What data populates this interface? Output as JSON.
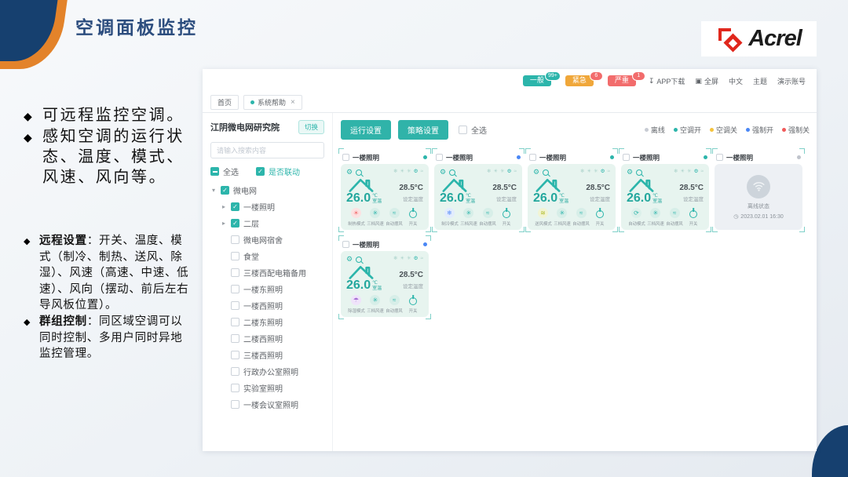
{
  "slide": {
    "title": "空调面板监控",
    "logo_text": "Acrel",
    "notes_top": [
      "可远程监控空调。",
      "感知空调的运行状态、温度、模式、风速、风向等。"
    ],
    "notes_bottom": [
      {
        "label": "远程设置",
        "text": "：开关、温度、模式（制冷、制热、送风、除湿）、风速（高速、中速、低速）、风向（摆动、前后左右导风板位置）。"
      },
      {
        "label": "群组控制",
        "text": "：同区域空调可以同时控制、多用户同时异地监控管理。"
      }
    ]
  },
  "app": {
    "header": {
      "pills": [
        {
          "label": "一般",
          "count": "99+",
          "color": "#2cb5ab",
          "badge_color": "#2cb5ab"
        },
        {
          "label": "紧急",
          "count": "6",
          "color": "#f0a73a",
          "badge_color": "#f26c6c"
        },
        {
          "label": "严重",
          "count": "1",
          "color": "#f26c6c",
          "badge_color": "#f26c6c"
        }
      ],
      "links": [
        {
          "icon": "download-icon",
          "glyph": "↧",
          "label": "APP下载"
        },
        {
          "icon": "fullscreen-icon",
          "glyph": "▣",
          "label": "全屏"
        },
        {
          "icon": "",
          "glyph": "",
          "label": "中文"
        },
        {
          "icon": "",
          "glyph": "",
          "label": "主题"
        },
        {
          "icon": "",
          "glyph": "",
          "label": "演示账号"
        }
      ]
    },
    "tabs": [
      {
        "label": "首页",
        "active": false
      },
      {
        "label": "系统帮助",
        "active": true
      }
    ],
    "sidebar": {
      "org_name": "江阴微电网研究院",
      "switch_label": "切换",
      "search_placeholder": "请输入搜索内容",
      "select_all_label": "全选",
      "linkage_label": "是否联动",
      "tree": [
        {
          "label": "微电网",
          "level": 0,
          "checked": true,
          "caret": "expanded"
        },
        {
          "label": "一楼照明",
          "level": 1,
          "checked": true,
          "caret": "collapsed"
        },
        {
          "label": "二层",
          "level": 1,
          "checked": true,
          "caret": "collapsed"
        },
        {
          "label": "微电网宿舍",
          "level": 1,
          "checked": false,
          "caret": "none"
        },
        {
          "label": "食堂",
          "level": 1,
          "checked": false,
          "caret": "none"
        },
        {
          "label": "三楼西配电箱备用",
          "level": 1,
          "checked": false,
          "caret": "none"
        },
        {
          "label": "一楼东照明",
          "level": 1,
          "checked": false,
          "caret": "none"
        },
        {
          "label": "一楼西照明",
          "level": 1,
          "checked": false,
          "caret": "none"
        },
        {
          "label": "二楼东照明",
          "level": 1,
          "checked": false,
          "caret": "none"
        },
        {
          "label": "二楼西照明",
          "level": 1,
          "checked": false,
          "caret": "none"
        },
        {
          "label": "三楼西照明",
          "level": 1,
          "checked": false,
          "caret": "none"
        },
        {
          "label": "行政办公室照明",
          "level": 1,
          "checked": false,
          "caret": "none"
        },
        {
          "label": "实验室照明",
          "level": 1,
          "checked": false,
          "caret": "none"
        },
        {
          "label": "一楼会议室照明",
          "level": 1,
          "checked": false,
          "caret": "none"
        }
      ]
    },
    "main": {
      "action_buttons": [
        "运行设置",
        "策略设置"
      ],
      "select_all_label": "全选",
      "legend": [
        {
          "label": "离线",
          "color": "#c8ccd4"
        },
        {
          "label": "空调开",
          "color": "#2cb5ab"
        },
        {
          "label": "空调关",
          "color": "#f5c33c"
        },
        {
          "label": "强制开",
          "color": "#4a87f5"
        },
        {
          "label": "强制关",
          "color": "#f05a5a"
        }
      ],
      "mini_icons": [
        "❄",
        "☀",
        "✳",
        "⚙",
        "≈"
      ],
      "card_defaults": {
        "room_temp": "26.0",
        "room_unit": "℃",
        "room_label": "室温",
        "set_temp": "28.5°C",
        "set_label": "设定温度",
        "fan": {
          "label": "三档风速",
          "glyph": "✳"
        },
        "swing": {
          "label": "自动摆风",
          "glyph": "≈"
        },
        "power": {
          "label": "开关"
        }
      },
      "cards": [
        {
          "name": "一楼照明",
          "status_color": "#2cb5ab",
          "offline": false,
          "mode": {
            "label": "制热模式",
            "glyph": "☀",
            "color": "#f26c6c",
            "bg": "#fbe2e2"
          }
        },
        {
          "name": "一楼照明",
          "status_color": "#4a87f5",
          "offline": false,
          "mode": {
            "label": "制冷模式",
            "glyph": "❄",
            "color": "#5b8ff9",
            "bg": "#e2ecfd"
          }
        },
        {
          "name": "一楼照明",
          "status_color": "#2cb5ab",
          "offline": false,
          "mode": {
            "label": "送风模式",
            "glyph": "≋",
            "color": "#b2bd2e",
            "bg": "#f1f4d4"
          }
        },
        {
          "name": "一楼照明",
          "status_color": "#2cb5ab",
          "offline": false,
          "mode": {
            "label": "自动模式",
            "glyph": "⟳",
            "color": "#2cb5ab",
            "bg": "#dcf0ea"
          }
        },
        {
          "name": "一楼照明",
          "status_color": "#c0c4cc",
          "offline": true,
          "offline_label": "离线状态",
          "offline_time": "2023.02.01 16:30"
        },
        {
          "name": "一楼照明",
          "status_color": "#4a87f5",
          "offline": false,
          "mode": {
            "label": "除湿模式",
            "glyph": "☂",
            "color": "#a66dd4",
            "bg": "#efe3fa"
          }
        }
      ]
    }
  }
}
